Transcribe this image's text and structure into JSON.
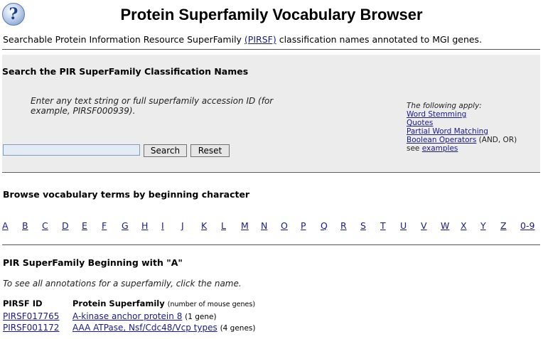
{
  "header": {
    "help_icon_glyph": "?",
    "title": "Protein Superfamily Vocabulary Browser",
    "subtitle_pre": "Searchable Protein Information Resource SuperFamily ",
    "subtitle_link": "(PIRSF)",
    "subtitle_post": " classification names annotated to MGI genes."
  },
  "search": {
    "heading": "Search the PIR SuperFamily Classification Names",
    "instructions": "Enter any text string or full superfamily accession ID (for example, PIRSF000939).",
    "input_value": "",
    "search_label": "Search",
    "reset_label": "Reset",
    "help": {
      "lead": "The following apply:",
      "links": [
        "Word Stemming",
        "Quotes",
        "Partial Word Matching",
        "Boolean Operators"
      ],
      "boolean_note": " (AND, OR)",
      "see_text": "see ",
      "examples_link": "examples"
    }
  },
  "browse": {
    "heading": "Browse vocabulary terms by beginning character",
    "letters": [
      "A",
      "B",
      "C",
      "D",
      "E",
      "F",
      "G",
      "H",
      "I",
      "J",
      "K",
      "L",
      "M",
      "N",
      "O",
      "P",
      "Q",
      "R",
      "S",
      "T",
      "U",
      "V",
      "W",
      "X",
      "Y",
      "Z",
      "0-9"
    ]
  },
  "results": {
    "heading": "PIR SuperFamily Beginning with \"A\"",
    "note": "To see all annotations for a superfamily, click the name.",
    "col_id": "PIRSF ID",
    "col_name": "Protein Superfamily",
    "col_name_note": "(number of mouse genes)",
    "rows": [
      {
        "id": "PIRSF017765",
        "name": "A-kinase anchor protein 8",
        "count": "(1 gene)"
      },
      {
        "id": "PIRSF001172",
        "name": "AAA ATPase, Nsf/Cdc48/Vcp types",
        "count": "(4 genes)"
      }
    ]
  }
}
